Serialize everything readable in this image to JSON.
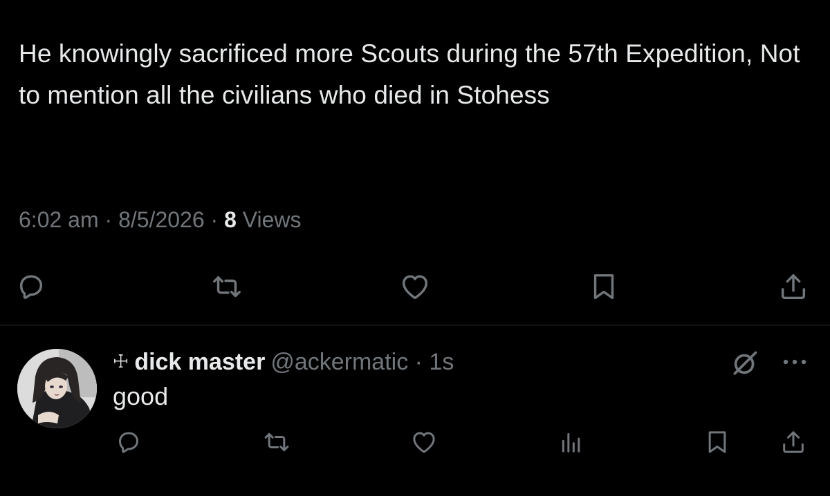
{
  "post": {
    "text": "He knowingly sacrificed more Scouts during the 57th Expedition, Not to mention all the civilians who died in Stohess",
    "time": "6:02 am",
    "sep1": " · ",
    "date": "8/5/2026",
    "sep2": " · ",
    "views_count": "8",
    "views_label": " Views"
  },
  "reply": {
    "badge": "☩",
    "display_name": "dick master",
    "handle": "@ackermatic",
    "sep": " · ",
    "time": "1s",
    "text": "good"
  },
  "icons": {
    "reply": "reply-icon",
    "repost": "repost-icon",
    "like": "like-icon",
    "bookmark": "bookmark-icon",
    "share": "share-icon",
    "views": "views-icon",
    "grok": "grok-icon",
    "more": "more-icon"
  },
  "colors": {
    "background": "#000000",
    "text": "#e7e9ea",
    "muted": "#71767b",
    "divider": "#2f3336"
  }
}
